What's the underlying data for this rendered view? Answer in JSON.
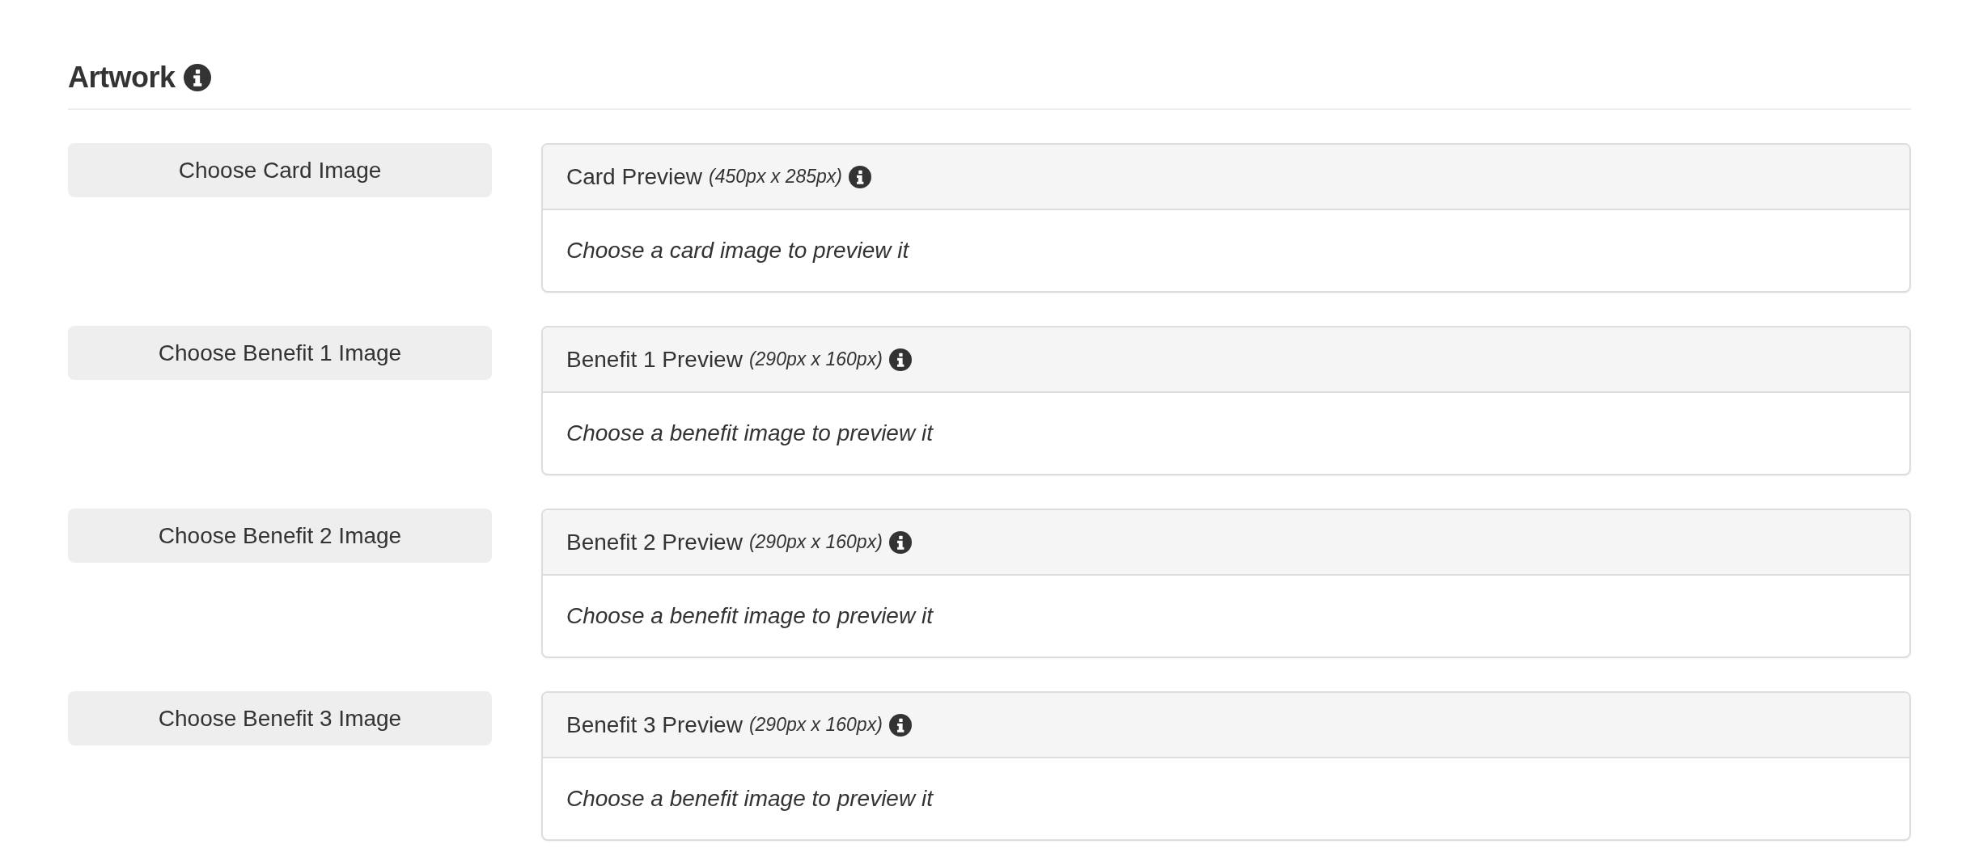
{
  "section": {
    "title": "Artwork"
  },
  "rows": [
    {
      "button": "Choose Card Image",
      "preview": {
        "title": "Card Preview",
        "dimensions": "(450px x 285px)",
        "message": "Choose a card image to preview it"
      }
    },
    {
      "button": "Choose Benefit 1 Image",
      "preview": {
        "title": "Benefit 1 Preview",
        "dimensions": "(290px x 160px)",
        "message": "Choose a benefit image to preview it"
      }
    },
    {
      "button": "Choose Benefit 2 Image",
      "preview": {
        "title": "Benefit 2 Preview",
        "dimensions": "(290px x 160px)",
        "message": "Choose a benefit image to preview it"
      }
    },
    {
      "button": "Choose Benefit 3 Image",
      "preview": {
        "title": "Benefit 3 Preview",
        "dimensions": "(290px x 160px)",
        "message": "Choose a benefit image to preview it"
      }
    }
  ]
}
